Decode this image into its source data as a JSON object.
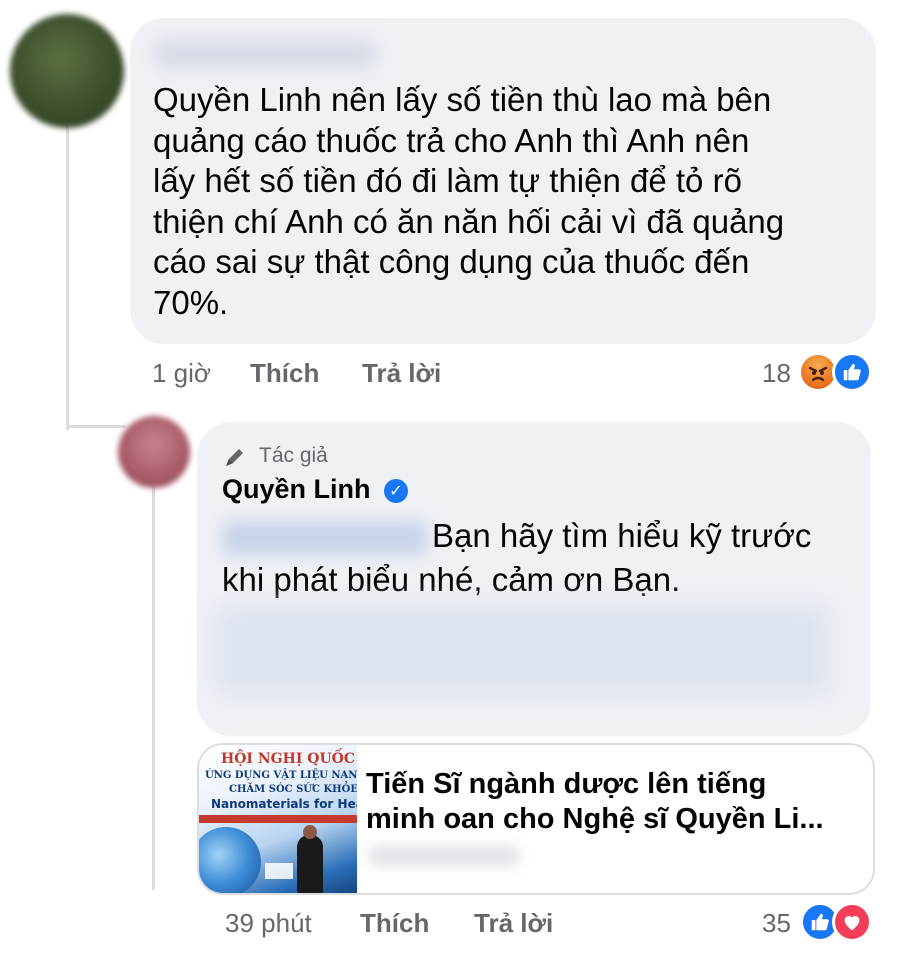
{
  "comment": {
    "text": "Quyền Linh nên lấy số tiền thù lao mà bên\nquảng cáo thuốc trả cho Anh thì Anh nên\nlấy hết số tiền đó đi làm tự thiện để tỏ rõ\nthiện chí Anh có ăn năn hối cải vì đã quảng\ncáo sai sự thật công dụng của thuốc đến\n70%.",
    "time": "1 giờ",
    "like_label": "Thích",
    "reply_label": "Trả lời",
    "reaction_count": "18",
    "reactions": [
      "angry",
      "like"
    ]
  },
  "reply": {
    "author_tag": "Tác giả",
    "author_name": "Quyền Linh",
    "text_line1": "Bạn hãy tìm hiểu kỹ trước",
    "text_line2": "khi phát biểu nhé, cảm ơn Bạn.",
    "link_preview": {
      "title": "Tiến Sĩ ngành dược lên tiếng\nminh oan cho Nghệ sĩ Quyền Li...",
      "thumb_line1": "HỘI NGHỊ QUỐC TẾ",
      "thumb_line2": "ỨNG DỤNG VẬT LIỆU NANO TRO",
      "thumb_line3": "CHĂM SÓC SỨC KHỎE",
      "thumb_line4": "Nanomaterials for Healthca"
    },
    "time": "39 phút",
    "like_label": "Thích",
    "reply_label": "Trả lời",
    "reaction_count": "35",
    "reactions": [
      "like",
      "love"
    ]
  },
  "colors": {
    "bubble": "#eff1f5",
    "meta_text": "#65676b",
    "like_blue": "#1877f2",
    "love_red": "#f33e58",
    "angry_orange": "#e9711c"
  }
}
